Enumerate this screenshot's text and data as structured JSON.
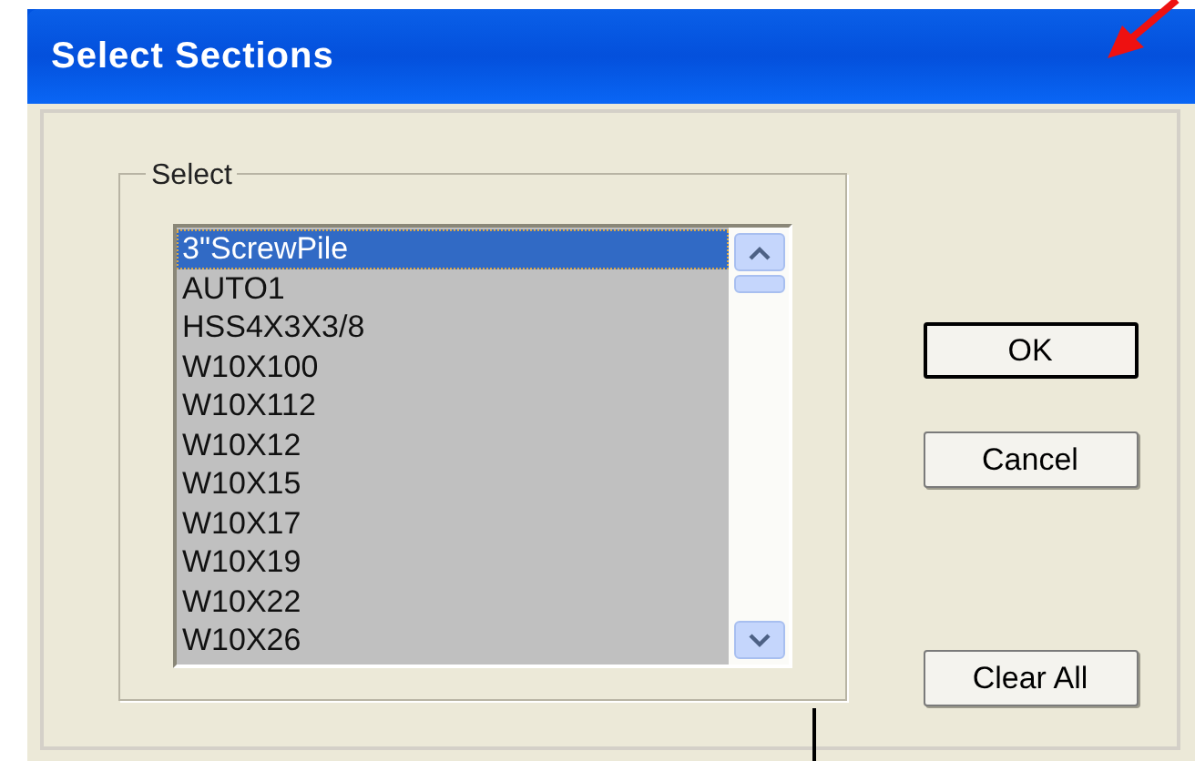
{
  "window": {
    "title": "Select Sections"
  },
  "group": {
    "label": "Select"
  },
  "list": {
    "items": [
      {
        "label": "3\"ScrewPile",
        "selected": true,
        "focused": true
      },
      {
        "label": "AUTO1",
        "selected": true,
        "focused": false
      },
      {
        "label": "HSS4X3X3/8",
        "selected": true,
        "focused": false
      },
      {
        "label": "W10X100",
        "selected": true,
        "focused": false
      },
      {
        "label": "W10X112",
        "selected": true,
        "focused": false
      },
      {
        "label": "W10X12",
        "selected": true,
        "focused": false
      },
      {
        "label": "W10X15",
        "selected": true,
        "focused": false
      },
      {
        "label": "W10X17",
        "selected": true,
        "focused": false
      },
      {
        "label": "W10X19",
        "selected": true,
        "focused": false
      },
      {
        "label": "W10X22",
        "selected": true,
        "focused": false
      },
      {
        "label": "W10X26",
        "selected": true,
        "focused": false
      }
    ]
  },
  "buttons": [
    {
      "label": "OK",
      "default": true
    },
    {
      "label": "Cancel",
      "default": false
    },
    {
      "label": "Clear All",
      "default": false
    }
  ]
}
